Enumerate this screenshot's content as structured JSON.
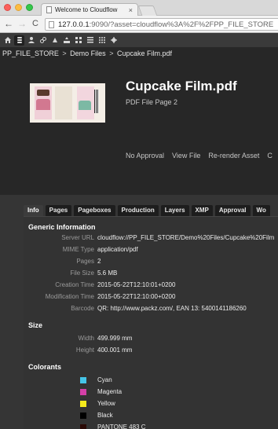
{
  "browser": {
    "tab_title": "Welcome to Cloudflow",
    "tab_close": "×",
    "url_host": "127.0.0.1",
    "url_rest": ":9090/?asset=cloudflow%3A%2F%2FPP_FILE_STORE",
    "back": "←",
    "forward": "→",
    "reload": "C"
  },
  "toolbar_icons": [
    "home-icon",
    "database-icon",
    "user-icon",
    "link-icon",
    "cloud-icon",
    "tray-icon",
    "grid-icon",
    "list-icon",
    "apps-icon",
    "gear-icon"
  ],
  "breadcrumb": [
    "PP_FILE_STORE",
    "Demo Files",
    "Cupcake Film.pdf"
  ],
  "breadcrumb_sep": ">",
  "document": {
    "title": "Cupcake Film.pdf",
    "subtitle": "PDF File Page 2"
  },
  "actions": [
    "No Approval",
    "View File",
    "Re-render Asset",
    "C"
  ],
  "tabs": [
    "Info",
    "Pages",
    "Pageboxes",
    "Production",
    "Layers",
    "XMP",
    "Approval",
    "Wo"
  ],
  "active_tab": "Info",
  "generic": {
    "heading": "Generic Information",
    "rows": [
      {
        "key": "Server URL",
        "value": "cloudflow://PP_FILE_STORE/Demo%20Files/Cupcake%20Film"
      },
      {
        "key": "MIME Type",
        "value": "application/pdf"
      },
      {
        "key": "Pages",
        "value": "2"
      },
      {
        "key": "File Size",
        "value": "5.6 MB"
      },
      {
        "key": "Creation Time",
        "value": "2015-05-22T12:10:01+0200"
      },
      {
        "key": "Modification Time",
        "value": "2015-05-22T12:10:00+0200"
      },
      {
        "key": "Barcode",
        "value": "QR: http://www.packz.com/, EAN 13: 5400141186260"
      }
    ]
  },
  "size": {
    "heading": "Size",
    "rows": [
      {
        "key": "Width",
        "value": "499.999 mm"
      },
      {
        "key": "Height",
        "value": "400.001 mm"
      }
    ]
  },
  "colorants": {
    "heading": "Colorants",
    "items": [
      {
        "name": "Cyan",
        "color": "#45c5e8"
      },
      {
        "name": "Magenta",
        "color": "#d43fa8"
      },
      {
        "name": "Yellow",
        "color": "#f5ea1c"
      },
      {
        "name": "Black",
        "color": "#000000"
      },
      {
        "name": "PANTONE 483 C",
        "color": "#2a0a06"
      }
    ]
  }
}
